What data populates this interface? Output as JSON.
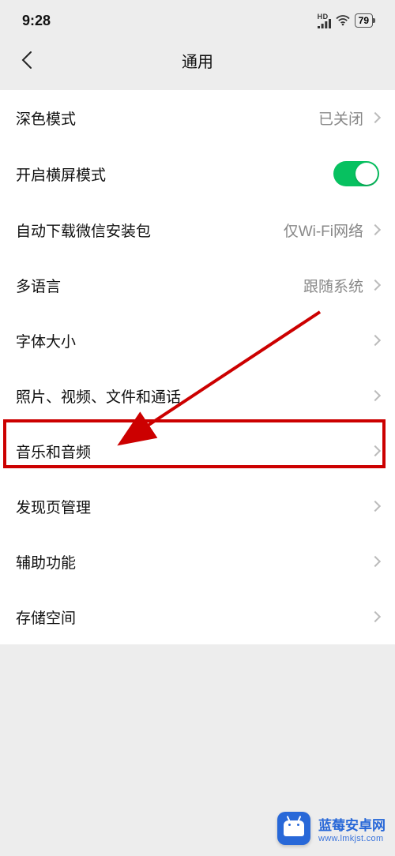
{
  "status": {
    "time": "9:28",
    "hd": "HD",
    "battery": "79"
  },
  "nav": {
    "title": "通用"
  },
  "rows": {
    "dark_mode": {
      "label": "深色模式",
      "value": "已关闭"
    },
    "landscape": {
      "label": "开启横屏模式"
    },
    "auto_dl": {
      "label": "自动下载微信安装包",
      "value": "仅Wi-Fi网络"
    },
    "multilang": {
      "label": "多语言",
      "value": "跟随系统"
    },
    "font": {
      "label": "字体大小"
    },
    "media": {
      "label": "照片、视频、文件和通话"
    },
    "audio": {
      "label": "音乐和音频"
    },
    "discover": {
      "label": "发现页管理"
    },
    "access": {
      "label": "辅助功能"
    },
    "storage": {
      "label": "存储空间"
    }
  },
  "watermark": {
    "line1": "蓝莓安卓网",
    "line2": "www.lmkjst.com"
  }
}
